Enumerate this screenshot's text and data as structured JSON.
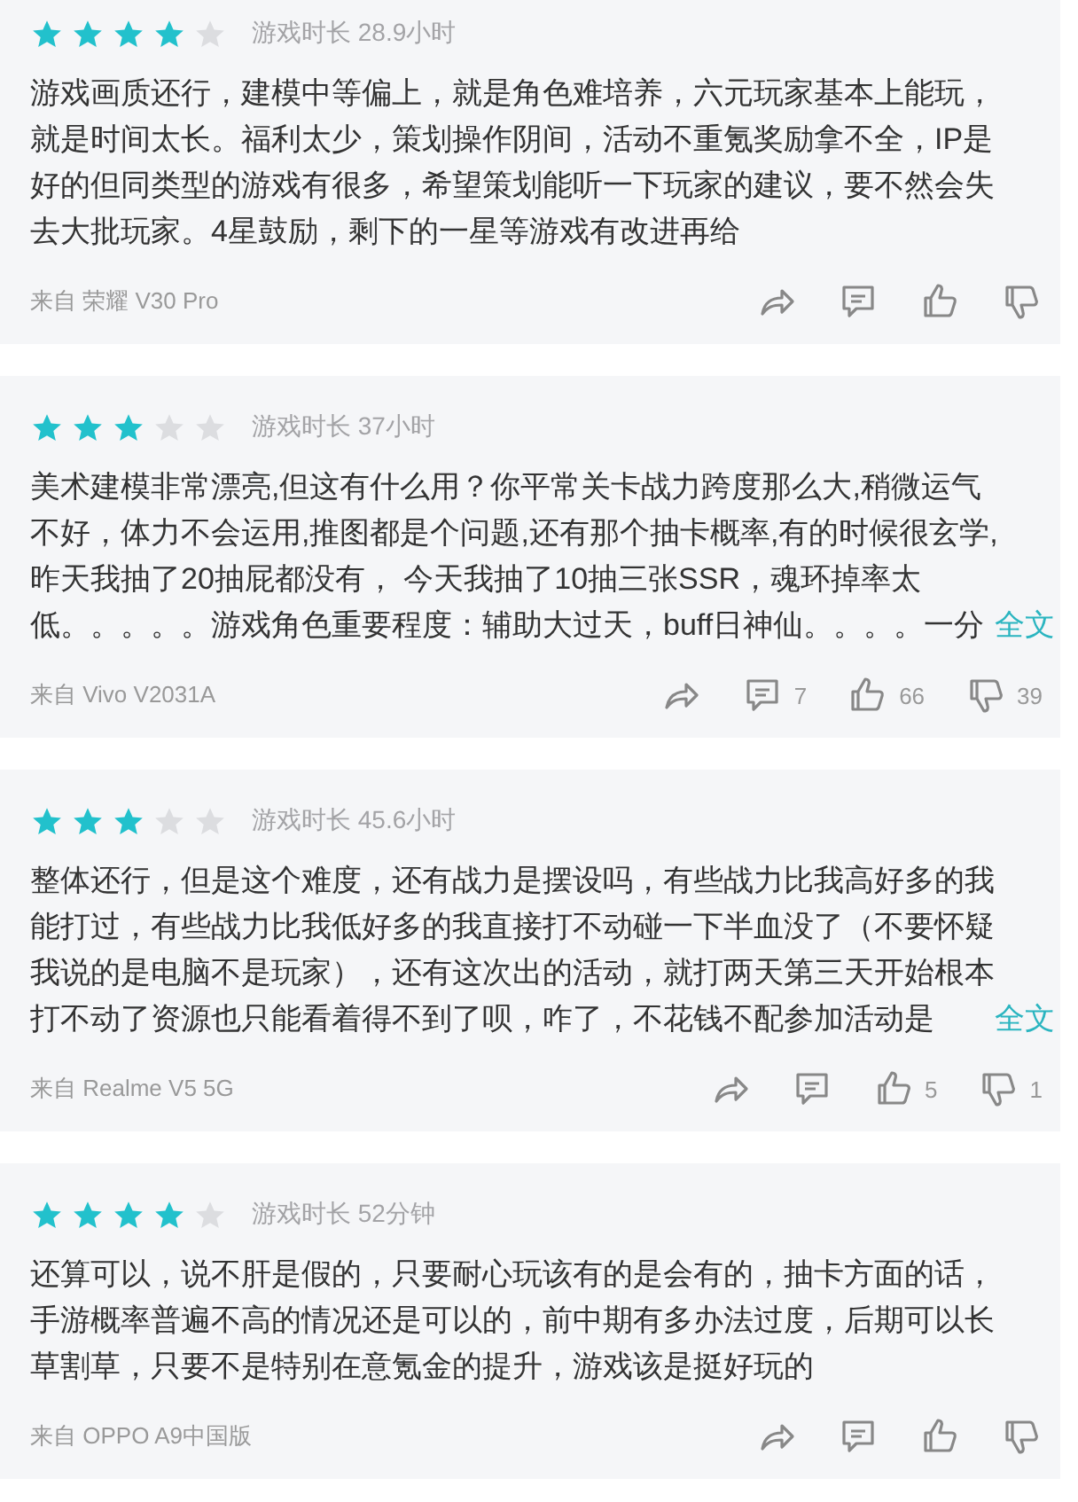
{
  "reviews": [
    {
      "stars": 4,
      "playtime": "游戏时长 28.9小时",
      "body": "游戏画质还行，建模中等偏上，就是角色难培养，六元玩家基本上能玩，就是时间太长。福利太少，策划操作阴间，活动不重氪奖励拿不全，IP是好的但同类型的游戏有很多，希望策划能听一下玩家的建议，要不然会失去大批玩家。4星鼓励，剩下的一星等游戏有改进再给",
      "device": "来自 荣耀 V30 Pro"
    },
    {
      "stars": 3,
      "playtime": "游戏时长 37小时",
      "body": "美术建模非常漂亮,但这有什么用？你平常关卡战力跨度那么大,稍微运气不好，体力不会运用,推图都是个问题,还有那个抽卡概率,有的时候很玄学,昨天我抽了20抽屁都没有， 今天我抽了10抽三张SSR，魂环掉率太低。。。。。游戏角色重要程度：辅助大过天，buff日神仙。。。。一分",
      "more_link": "全文",
      "device": "来自 Vivo V2031A",
      "comments": "7",
      "likes": "66",
      "dislikes": "39"
    },
    {
      "stars": 3,
      "playtime": "游戏时长 45.6小时",
      "body": "整体还行，但是这个难度，还有战力是摆设吗，有些战力比我高好多的我能打过，有些战力比我低好多的我直接打不动碰一下半血没了（不要怀疑我说的是电脑不是玩家），还有这次出的活动，就打两天第三天开始根本打不动了资源也只能看着得不到了呗，咋了，不花钱不配参加活动是",
      "more_link": "全文",
      "device": "来自 Realme V5 5G",
      "likes": "5",
      "dislikes": "1"
    },
    {
      "stars": 4,
      "playtime": "游戏时长 52分钟",
      "body": "还算可以，说不肝是假的，只要耐心玩该有的是会有的，抽卡方面的话，手游概率普遍不高的情况还是可以的，前中期有多办法过度，后期可以长草割草，只要不是特别在意氪金的提升，游戏该是挺好玩的",
      "device": "来自 OPPO A9中国版"
    }
  ]
}
